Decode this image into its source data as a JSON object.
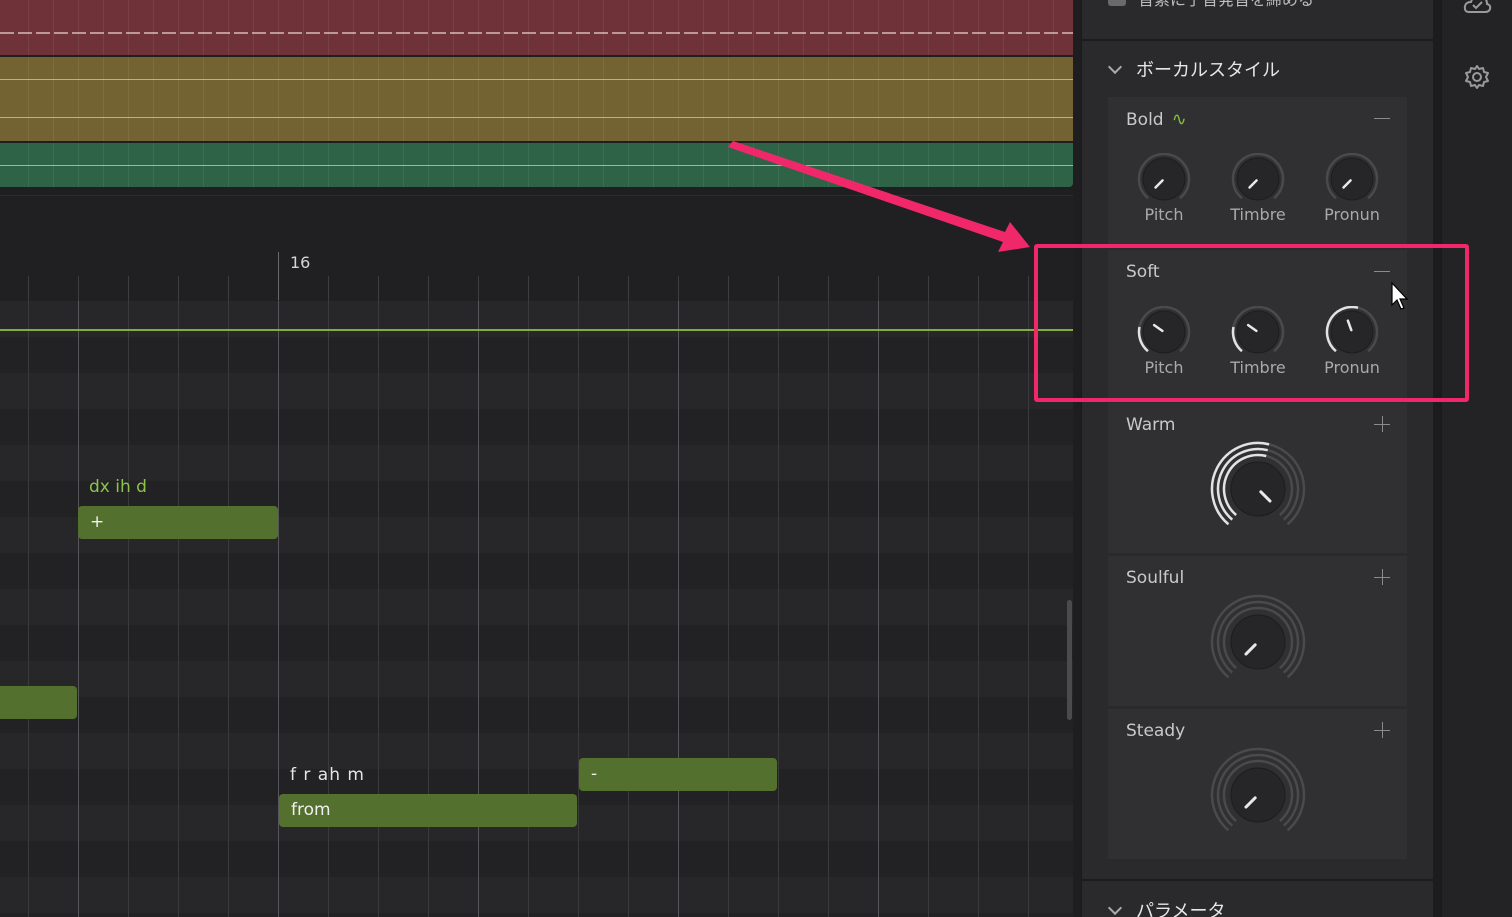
{
  "editor": {
    "ruler_label": "16",
    "notes": [
      {
        "lyric": "+",
        "phoneme": "dx ih d"
      },
      {
        "lyric": "",
        "phoneme": ""
      },
      {
        "lyric": "from",
        "phoneme": "f r ah m"
      },
      {
        "lyric": "-",
        "phoneme": ""
      }
    ]
  },
  "panel": {
    "top_setting_text": "音素に子音発音を締める",
    "section_title": "ボーカルスタイル",
    "bottom_section_title": "パラメータ",
    "styles": [
      {
        "name": "Bold",
        "expanded": true,
        "has_wave": true,
        "btn": "collapse",
        "knobs": [
          "Pitch",
          "Timbre",
          "Pronun"
        ]
      },
      {
        "name": "Soft",
        "expanded": true,
        "has_wave": false,
        "btn": "collapse",
        "knobs": [
          "Pitch",
          "Timbre",
          "Pronun"
        ]
      },
      {
        "name": "Warm",
        "expanded": false,
        "btn": "expand"
      },
      {
        "name": "Soulful",
        "expanded": false,
        "btn": "expand"
      },
      {
        "name": "Steady",
        "expanded": false,
        "btn": "expand"
      }
    ]
  },
  "colors": {
    "accent_green": "#7fae3a",
    "note_fill": "#54702f",
    "highlight": "#f0286a",
    "lane_red": "#6f3239",
    "lane_yellow": "#736332",
    "lane_green": "#2f6347"
  },
  "icons": [
    "cloud-check-icon",
    "gear-icon",
    "chevron-down-icon",
    "wave-icon",
    "minus-icon",
    "plus-icon",
    "cursor-icon"
  ]
}
